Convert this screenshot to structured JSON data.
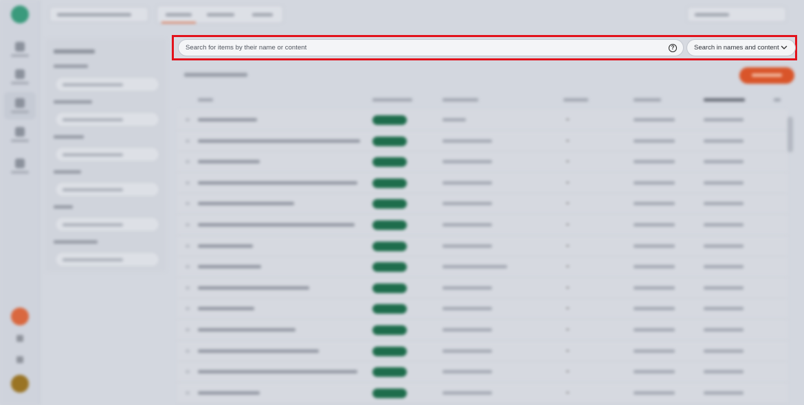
{
  "search": {
    "placeholder": "Search for items by their name or content",
    "help_icon": "?",
    "mode_selected": "Search in names and content",
    "icons": {
      "help": "help-circle-icon",
      "dropdown": "chevron-down-icon"
    }
  },
  "colors": {
    "highlight_border": "#e3121b",
    "accent": "#d9552a",
    "status_pill": "#1e6d4c",
    "brand_logo": "#3a9a7c"
  }
}
